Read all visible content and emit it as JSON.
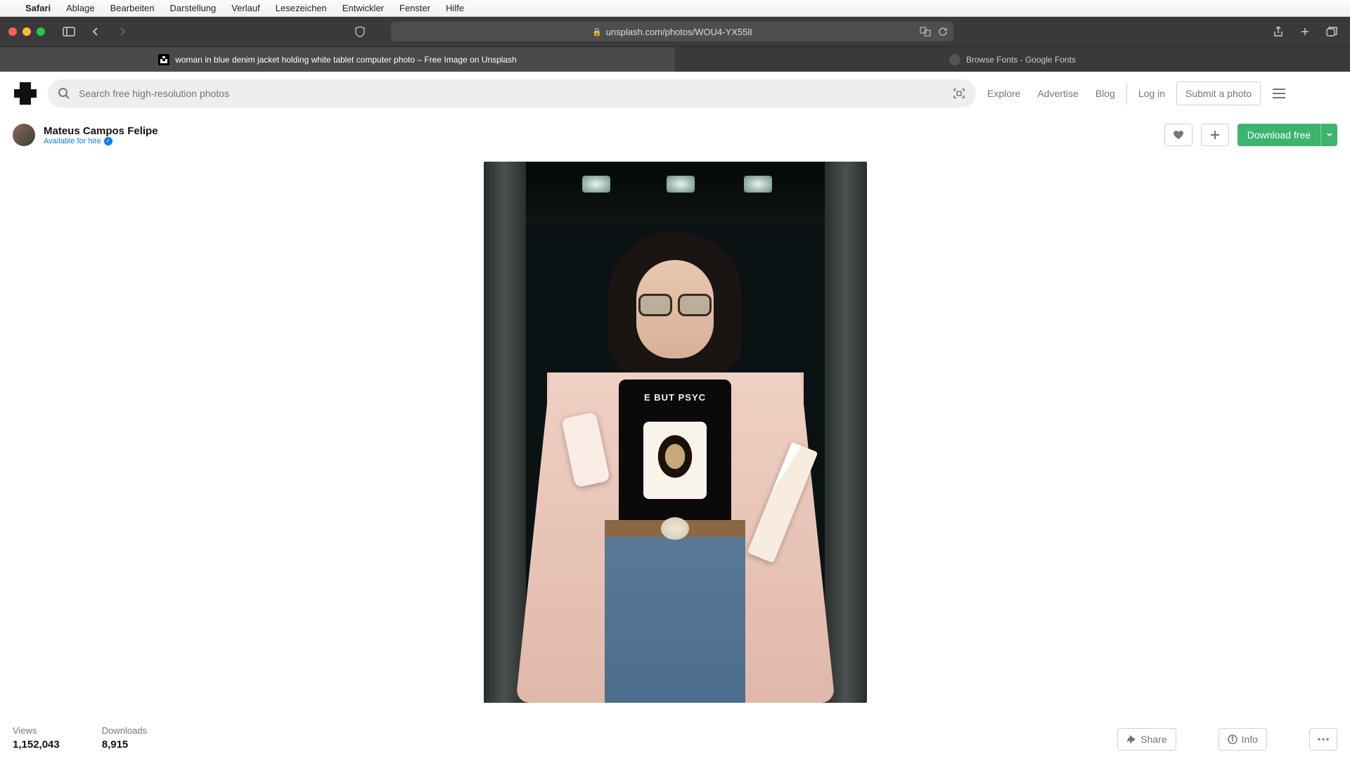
{
  "menubar": {
    "app": "Safari",
    "items": [
      "Ablage",
      "Bearbeiten",
      "Darstellung",
      "Verlauf",
      "Lesezeichen",
      "Entwickler",
      "Fenster",
      "Hilfe"
    ]
  },
  "browser": {
    "url": "unsplash.com/photos/WOU4-YX55lI",
    "tabs": [
      "woman in blue denim jacket holding white tablet computer photo – Free Image on Unsplash",
      "Browse Fonts - Google Fonts"
    ]
  },
  "site": {
    "search_placeholder": "Search free high-resolution photos",
    "nav": {
      "explore": "Explore",
      "advertise": "Advertise",
      "blog": "Blog"
    },
    "login": "Log in",
    "submit": "Submit a photo"
  },
  "author": {
    "name": "Mateus Campos Felipe",
    "hire": "Available for hire"
  },
  "download": {
    "label": "Download free"
  },
  "shirt_text": "E BUT PSYC",
  "stats": {
    "views_label": "Views",
    "views_value": "1,152,043",
    "downloads_label": "Downloads",
    "downloads_value": "8,915"
  },
  "actions": {
    "share": "Share",
    "info": "Info"
  }
}
